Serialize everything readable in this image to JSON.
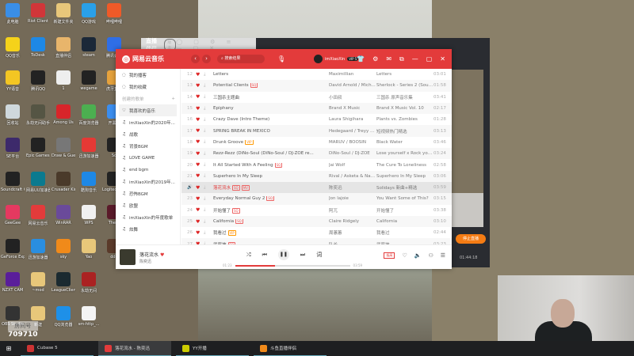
{
  "desktop": {
    "icons": [
      {
        "label": "此电脑",
        "color": "#3a8ee6"
      },
      {
        "label": "Riot Client",
        "color": "#d13639"
      },
      {
        "label": "新建文件夹",
        "color": "#e8c77a"
      },
      {
        "label": "QQ游戏",
        "color": "#2aa0e8"
      },
      {
        "label": "哔哩哔哩",
        "color": "#ef5a28"
      },
      {
        "label": "QQ音乐",
        "color": "#f5d21a"
      },
      {
        "label": "ToDesk",
        "color": "#1e88e5"
      },
      {
        "label": "直播伴侣",
        "color": "#e8b56b"
      },
      {
        "label": "steam",
        "color": "#1b2838"
      },
      {
        "label": "腾讯会议",
        "color": "#2f6ee6"
      },
      {
        "label": "YY语音",
        "color": "#f3c623"
      },
      {
        "label": "腾讯QQ",
        "color": "#222"
      },
      {
        "label": "1",
        "color": "#eee"
      },
      {
        "label": "wegame",
        "color": "#222"
      },
      {
        "label": "虎牙直播",
        "color": "#e6a23c"
      },
      {
        "label": "回收站",
        "color": "#cfd8dc"
      },
      {
        "label": "永劫无间助手",
        "color": "#554"
      },
      {
        "label": "Among Us",
        "color": "#d8252a"
      },
      {
        "label": "百度浏览器",
        "color": "#4caf50"
      },
      {
        "label": "开黑啦",
        "color": "#3b8ef0"
      },
      {
        "label": "SE平台",
        "color": "#3d2a6b"
      },
      {
        "label": "Epic Games Launcher",
        "color": "#222"
      },
      {
        "label": "Draw & Guess",
        "color": "#777"
      },
      {
        "label": "迅游加速器",
        "color": "#e53935"
      },
      {
        "label": "Sq",
        "color": "#222"
      },
      {
        "label": "Soundcraft Control",
        "color": "#222"
      },
      {
        "label": "网易UU加速器",
        "color": "#0b7a8f"
      },
      {
        "label": "Crusader Kings",
        "color": "#4a3a2a"
      },
      {
        "label": "酷狗音乐",
        "color": "#1e88e5"
      },
      {
        "label": "Logitech G HUB",
        "color": "#222"
      },
      {
        "label": "GeeGee",
        "color": "#e53960"
      },
      {
        "label": "网易云音乐",
        "color": "#e33b3b"
      },
      {
        "label": "WinRAR",
        "color": "#6a4a9a"
      },
      {
        "label": "WPS",
        "color": "#f0f0f0"
      },
      {
        "label": "The C",
        "color": "#5a1a2a"
      },
      {
        "label": "GeForce Experience",
        "color": "#222"
      },
      {
        "label": "迅游加速器",
        "color": "#2a8ee0"
      },
      {
        "label": "sky",
        "color": "#f08a1a"
      },
      {
        "label": "Yao",
        "color": "#e8c77a"
      },
      {
        "label": "ddd",
        "color": "#5a3a2a"
      },
      {
        "label": "NZXT CAM",
        "color": "#5a1e9a"
      },
      {
        "label": "~mod",
        "color": "#e8c77a"
      },
      {
        "label": "LeagueClient",
        "color": "#1b2a30"
      },
      {
        "label": "永劫无间",
        "color": "#a22"
      },
      {
        "label": "",
        "color": "transparent"
      },
      {
        "label": "OBS Studio",
        "color": "#333"
      },
      {
        "label": "新建",
        "color": "#e8c77a"
      },
      {
        "label": "QQ浏览器",
        "color": "#1e90e8"
      },
      {
        "label": "sm-http_...",
        "color": "#f4f4f4"
      },
      {
        "label": "",
        "color": "transparent"
      }
    ]
  },
  "room": {
    "label": "房间号",
    "number": "709710"
  },
  "live_app": {
    "title": "直播伴侣",
    "version": "版本",
    "stop_button": "停止直播",
    "duration": "01:44:18"
  },
  "netease": {
    "brand": "网易云音乐",
    "accent": "#e33b3b",
    "search_value": "搜索结果",
    "user": "imXiaoXin",
    "vip": "VIP 5",
    "sidebar": [
      {
        "label": "我的播客",
        "type": "item"
      },
      {
        "label": "我的收藏",
        "type": "item"
      },
      {
        "label": "创建的歌单",
        "type": "section"
      },
      {
        "label": "我喜欢的音乐",
        "type": "active"
      },
      {
        "label": "imXiaoXin的2020年...",
        "type": "pl"
      },
      {
        "label": "战歌",
        "type": "pl"
      },
      {
        "label": "背景BGM",
        "type": "pl"
      },
      {
        "label": "LOVE GAME",
        "type": "pl"
      },
      {
        "label": "end bgm",
        "type": "pl"
      },
      {
        "label": "imXiaoXin的2019年...",
        "type": "pl"
      },
      {
        "label": "恐怖BGM",
        "type": "pl"
      },
      {
        "label": "欧盟",
        "type": "pl"
      },
      {
        "label": "imXiaoXin的年度歌单",
        "type": "pl"
      },
      {
        "label": "炫舞",
        "type": "pl"
      }
    ],
    "songs": [
      {
        "n": "12",
        "title": "Letters",
        "tags": [],
        "artist": "Maximillian",
        "album": "Letters",
        "dur": "03:01"
      },
      {
        "n": "13",
        "title": "Potential Clients",
        "tags": [
          "SQ"
        ],
        "artist": "David Arnold / Mich...",
        "album": "Sherlock - Series 2 (Soundtr...",
        "dur": "01:58"
      },
      {
        "n": "14",
        "title": "三国杀主题曲",
        "tags": [],
        "artist": "小田叔",
        "album": "三国杀 原声音乐集",
        "dur": "03:41"
      },
      {
        "n": "15",
        "title": "Epiphany",
        "tags": [],
        "artist": "Brand X Music",
        "album": "Brand X Music Vol. 10",
        "dur": "02:17"
      },
      {
        "n": "16",
        "title": "Crazy Dave (Intro Theme)",
        "tags": [],
        "artist": "Laura Shigihara",
        "album": "Plants vs. Zombies",
        "dur": "01:28"
      },
      {
        "n": "17",
        "title": "SPRING BREAK IN MEXICO",
        "tags": [],
        "artist": "Hedegaard / Treyy ...",
        "album": "短视频热门精选",
        "dur": "03:13"
      },
      {
        "n": "18",
        "title": "Drunk Groove",
        "tags": [
          "VIP"
        ],
        "artist": "MARUV / BOOSIN",
        "album": "Black Water",
        "dur": "03:46"
      },
      {
        "n": "19",
        "title": "Rezz-Rezz (DiNo-Soul (DiNo-Soul / DJ-ZOE re...",
        "tags": [],
        "artist": "DiNo-Soul / DJ-ZOE",
        "album": "Lose yourself x Rock you x ...",
        "dur": "03:24"
      },
      {
        "n": "20",
        "title": "It All Started With A Feeling",
        "tags": [
          "SQ"
        ],
        "artist": "Jai Wolf",
        "album": "The Cure To Loneliness",
        "dur": "02:58"
      },
      {
        "n": "21",
        "title": "Superhero In My Sleep",
        "tags": [],
        "artist": "Rival / Asketa & Nat...",
        "album": "Superhero In My Sleep",
        "dur": "03:06"
      },
      {
        "n": "",
        "title": "落花流水",
        "tags": [
          "SQ",
          "MV"
        ],
        "artist": "陈奕迅",
        "album": "Solidays 新曲+精选",
        "dur": "03:59",
        "playing": true
      },
      {
        "n": "23",
        "title": "Everyday Normal Guy 2",
        "tags": [
          "SQ"
        ],
        "artist": "Jon lajoie",
        "album": "You Want Some of This?",
        "dur": "03:15"
      },
      {
        "n": "24",
        "title": "开始懂了",
        "tags": [
          "SQ"
        ],
        "artist": "阿兀",
        "album": "开始懂了",
        "dur": "03:38"
      },
      {
        "n": "25",
        "title": "California",
        "tags": [
          "SQ"
        ],
        "artist": "Claire Ridgely",
        "album": "California",
        "dur": "03:10"
      },
      {
        "n": "26",
        "title": "我看过",
        "tags": [
          "VIP"
        ],
        "artist": "周蕙蕙",
        "album": "我看过",
        "dur": "02:44"
      },
      {
        "n": "27",
        "title": "武家坡",
        "tags": [
          "SQ"
        ],
        "artist": "队长",
        "album": "武家坡",
        "dur": "03:23"
      }
    ],
    "player": {
      "title": "落花流水",
      "artist": "陈奕迅",
      "elapsed": "01:23",
      "total": "03:59",
      "progress": 0.35,
      "quality": "极高",
      "lyrics": "词"
    }
  },
  "taskbar": [
    {
      "label": "Cubase 5",
      "color": "#c33",
      "active": false
    },
    {
      "label": "落花流水 - 陈奕迅",
      "color": "#e33b3b",
      "active": true
    },
    {
      "label": "YY开播",
      "color": "#cc0",
      "active": false
    },
    {
      "label": "斗鱼直播伴侣",
      "color": "#f08a1a",
      "active": false
    }
  ]
}
